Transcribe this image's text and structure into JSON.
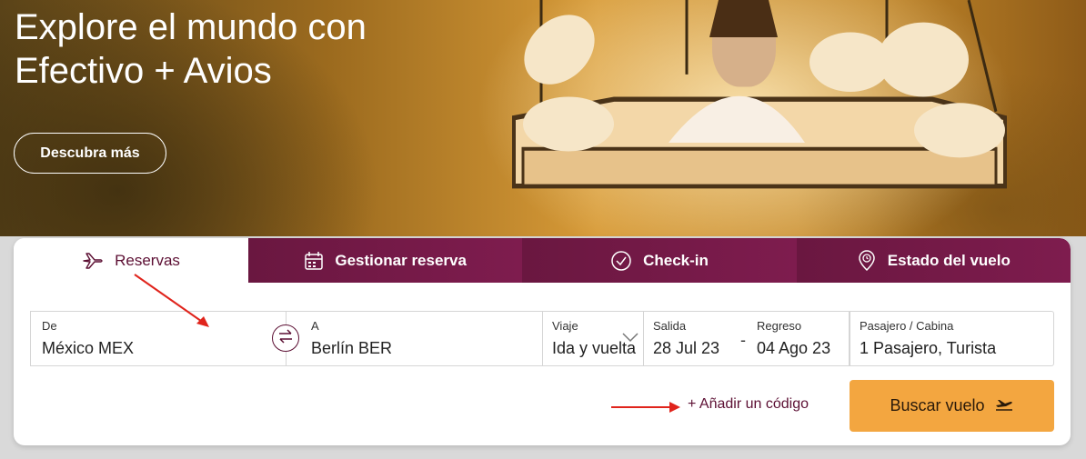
{
  "hero": {
    "headline": "Explore el mundo con Efectivo + Avios",
    "cta_label": "Descubra más"
  },
  "tabs": [
    {
      "label": "Reservas",
      "icon": "plane-icon",
      "active": true
    },
    {
      "label": "Gestionar reserva",
      "icon": "calendar-icon",
      "active": false
    },
    {
      "label": "Check-in",
      "icon": "check-circle-icon",
      "active": false
    },
    {
      "label": "Estado del vuelo",
      "icon": "location-clock-icon",
      "active": false
    }
  ],
  "form": {
    "origin": {
      "label": "De",
      "value": "México MEX"
    },
    "destination": {
      "label": "A",
      "value": "Berlín BER"
    },
    "trip_type": {
      "label": "Viaje",
      "value": "Ida y vuelta"
    },
    "departure": {
      "label": "Salida",
      "value": "28 Jul 23"
    },
    "return": {
      "label": "Regreso",
      "value": "04 Ago 23"
    },
    "date_separator": "-",
    "passengers": {
      "label": "Pasajero / Cabina",
      "value": "1 Pasajero, Turista"
    },
    "promo_link": "+ Añadir un código",
    "search_label": "Buscar vuelo"
  },
  "colors": {
    "brand": "#5c0f33",
    "tab_bg": "#6a1740",
    "cta": "#f3a640",
    "annotation": "#e0241c"
  }
}
